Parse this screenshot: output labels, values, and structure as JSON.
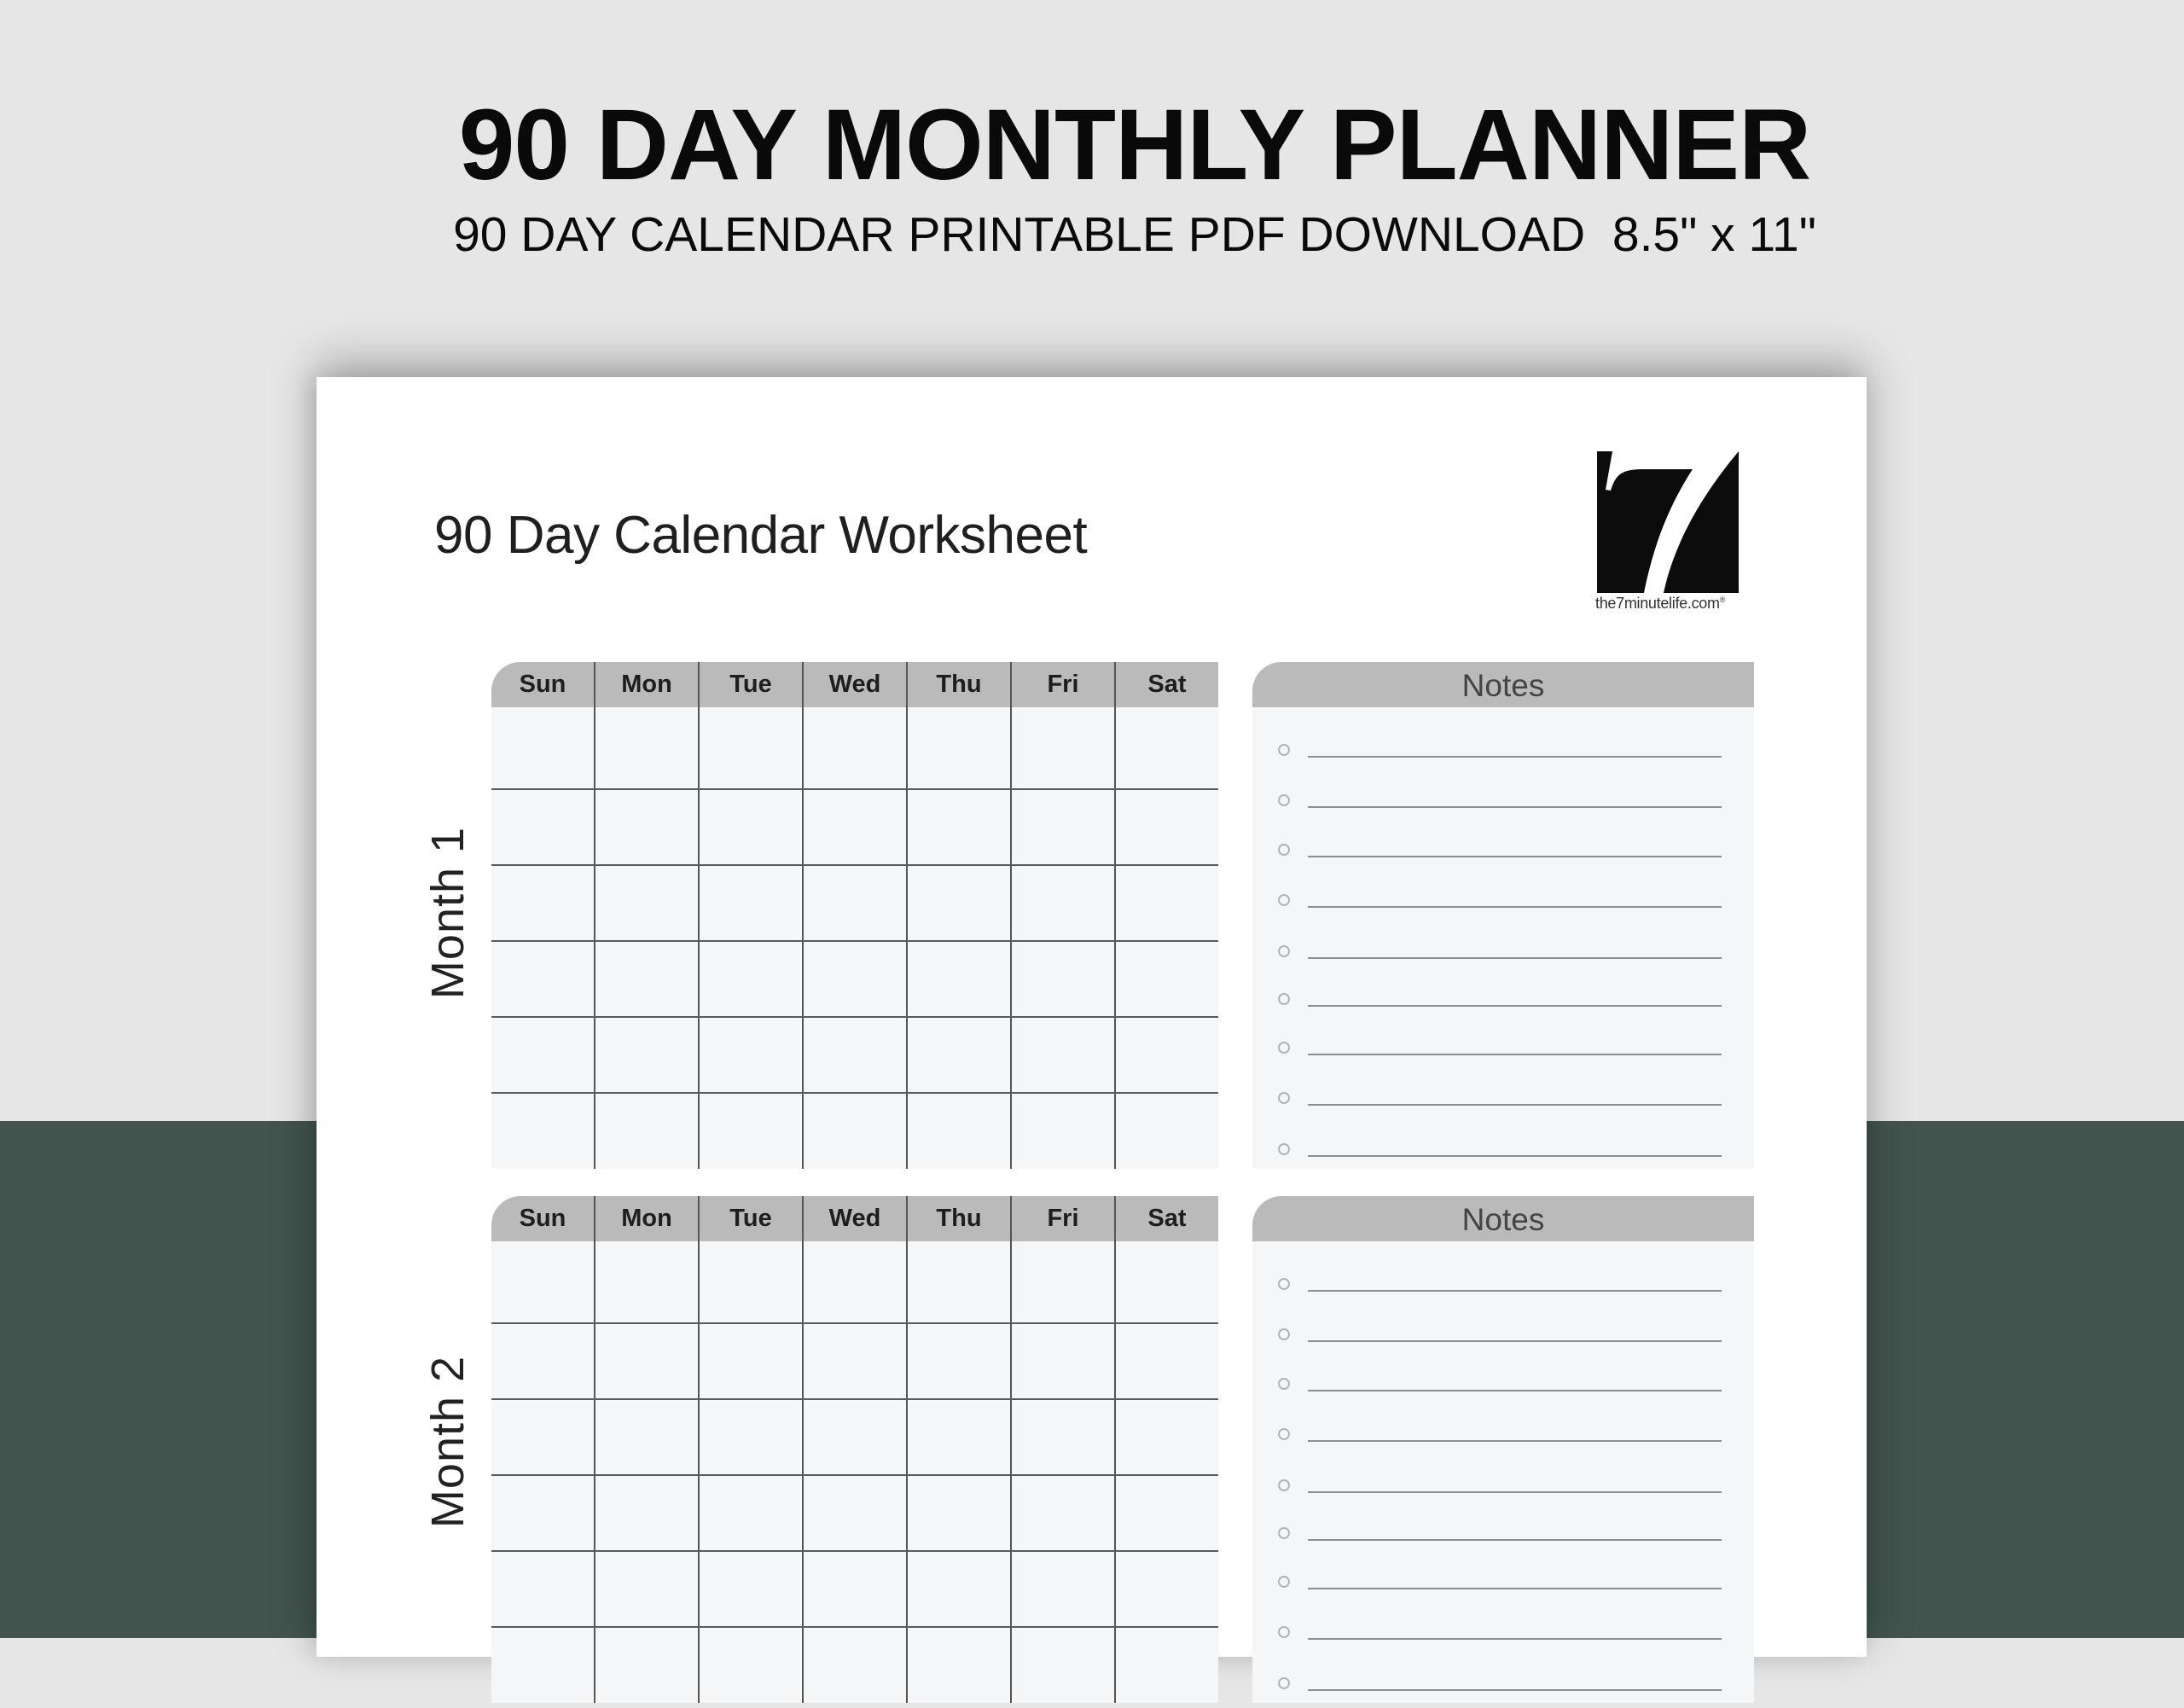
{
  "banner": {
    "title": "90 DAY MONTHLY PLANNER",
    "subtitle": "90 DAY CALENDAR PRINTABLE PDF DOWNLOAD  8.5\" x 11\""
  },
  "colors": {
    "background_light": "#e6e6e6",
    "background_green": "#43544e",
    "header_gray": "#bababa",
    "cell_background": "#f5f6f8",
    "grid_line": "#555555",
    "text_dark": "#0a0a0a"
  },
  "worksheet": {
    "title": "90 Day Calendar Worksheet",
    "logo": {
      "icon": "seven-logo-icon",
      "text": "the7minutelife.com",
      "registered_mark": "®"
    }
  },
  "weekdays": [
    "Sun",
    "Mon",
    "Tue",
    "Wed",
    "Thu",
    "Fri",
    "Sat"
  ],
  "months": [
    {
      "label": "Month 1",
      "rows": 6,
      "notes_header": "Notes",
      "note_lines": 9
    },
    {
      "label": "Month 2",
      "rows": 6,
      "notes_header": "Notes",
      "note_lines": 9
    }
  ]
}
